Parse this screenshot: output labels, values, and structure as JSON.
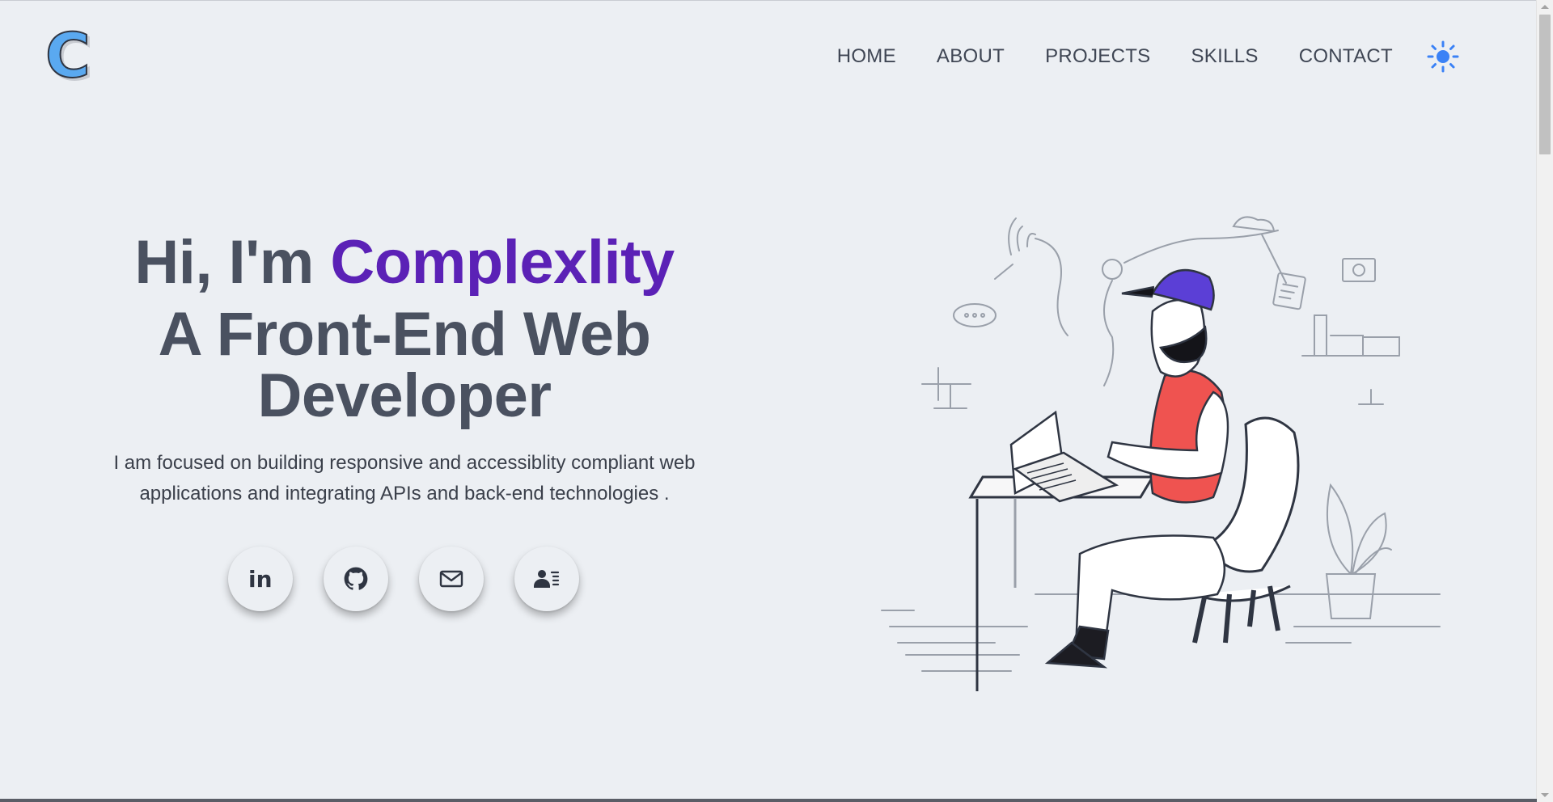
{
  "header": {
    "logo_letter": "C",
    "nav": [
      "HOME",
      "ABOUT",
      "PROJECTS",
      "SKILLS",
      "CONTACT"
    ],
    "theme_icon": "sun-icon"
  },
  "hero": {
    "greeting_prefix": "Hi, I'm ",
    "name": "Complexlity",
    "role_line1": "A Front-End Web",
    "role_line2": "Developer",
    "intro": "I am focused on building responsive and accessiblity compliant web applications and integrating APIs and back-end technologies ."
  },
  "social": [
    {
      "icon": "linkedin-icon",
      "text": "in"
    },
    {
      "icon": "github-icon"
    },
    {
      "icon": "mail-icon"
    },
    {
      "icon": "contact-card-icon"
    }
  ],
  "colors": {
    "background": "#eceff3",
    "accent": "#5b21b6",
    "text": "#4a5160",
    "sun": "#3b82f6",
    "logo": "#5aa9f0"
  }
}
